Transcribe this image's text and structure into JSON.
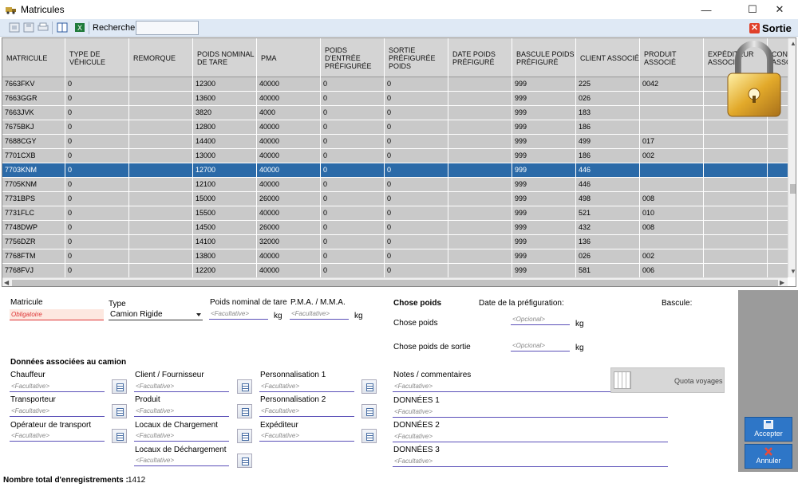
{
  "window": {
    "title": "Matricules",
    "minimize_glyph": "—",
    "maximize_glyph": "☐",
    "close_glyph": "✕"
  },
  "toolbar": {
    "search_label": "Rechercher:",
    "search_value": "",
    "exit_label": "Sortie",
    "icons": [
      "first-record-icon",
      "save-icon",
      "print-icon",
      "columns-icon",
      "excel-icon"
    ]
  },
  "grid": {
    "columns": [
      "MATRICULE",
      "TYPE DE VÉHICULE",
      "REMORQUE",
      "POIDS NOMINAL DE TARE",
      "PMA",
      "POIDS D'ENTRÉE PRÉFIGURÉE",
      "SORTIE PRÉFIGURÉE POIDS",
      "DATE POIDS PRÉFIGURÉ",
      "BASCULE POIDS PRÉFIGURÉ",
      "CLIENT ASSOCIÉ",
      "PRODUIT ASSOCIÉ",
      "EXPÉDITEUR ASSOCIÉ",
      "CON... ASSO..."
    ],
    "rows": [
      [
        "7663FKV",
        "0",
        "",
        "12300",
        "40000",
        "0",
        "0",
        "",
        "999",
        "225",
        "0042",
        "",
        ""
      ],
      [
        "7663GGR",
        "0",
        "",
        "13600",
        "40000",
        "0",
        "0",
        "",
        "999",
        "026",
        "",
        "",
        ""
      ],
      [
        "7663JVK",
        "0",
        "",
        "3820",
        "4000",
        "0",
        "0",
        "",
        "999",
        "183",
        "",
        "",
        ""
      ],
      [
        "7675BKJ",
        "0",
        "",
        "12800",
        "40000",
        "0",
        "0",
        "",
        "999",
        "186",
        "",
        "",
        ""
      ],
      [
        "7688CGY",
        "0",
        "",
        "14400",
        "40000",
        "0",
        "0",
        "",
        "999",
        "499",
        "017",
        "",
        ""
      ],
      [
        "7701CXB",
        "0",
        "",
        "13000",
        "40000",
        "0",
        "0",
        "",
        "999",
        "186",
        "002",
        "",
        ""
      ],
      [
        "7703KNM",
        "0",
        "",
        "12700",
        "40000",
        "0",
        "0",
        "",
        "999",
        "446",
        "",
        "",
        ""
      ],
      [
        "7705KNM",
        "0",
        "",
        "12100",
        "40000",
        "0",
        "0",
        "",
        "999",
        "446",
        "",
        "",
        ""
      ],
      [
        "7731BPS",
        "0",
        "",
        "15000",
        "26000",
        "0",
        "0",
        "",
        "999",
        "498",
        "008",
        "",
        ""
      ],
      [
        "7731FLC",
        "0",
        "",
        "15500",
        "40000",
        "0",
        "0",
        "",
        "999",
        "521",
        "010",
        "",
        ""
      ],
      [
        "7748DWP",
        "0",
        "",
        "14500",
        "26000",
        "0",
        "0",
        "",
        "999",
        "432",
        "008",
        "",
        ""
      ],
      [
        "7756DZR",
        "0",
        "",
        "14100",
        "32000",
        "0",
        "0",
        "",
        "999",
        "136",
        "",
        "",
        ""
      ],
      [
        "7768FTM",
        "0",
        "",
        "13800",
        "40000",
        "0",
        "0",
        "",
        "999",
        "026",
        "002",
        "",
        ""
      ],
      [
        "7768FVJ",
        "0",
        "",
        "12200",
        "40000",
        "0",
        "0",
        "",
        "999",
        "581",
        "006",
        "",
        ""
      ]
    ],
    "selected_row": 6
  },
  "form": {
    "matricule": {
      "label": "Matricule",
      "placeholder": "Obligatoire"
    },
    "type": {
      "label": "Type",
      "value": "Camion Rigide"
    },
    "tare": {
      "label": "Poids nominal de tare",
      "placeholder": "<Facultative>",
      "unit": "kg"
    },
    "pma": {
      "label": "P.M.A. / M.M.A.",
      "placeholder": "<Facultative>",
      "unit": "kg"
    },
    "chose_poids_title": "Chose poids",
    "date_prefig_label": "Date de la préfiguration:",
    "bascule_label": "Bascule:",
    "chose_poids": {
      "label": "Chose poids",
      "placeholder": "<Opcional>",
      "unit": "kg"
    },
    "chose_poids_sortie": {
      "label": "Chose poids de sortie",
      "placeholder": "<Opcional>",
      "unit": "kg"
    },
    "section_title": "Données associées au camion",
    "chauffeur": {
      "label": "Chauffeur",
      "placeholder": "<Facultative>"
    },
    "transporteur": {
      "label": "Transporteur",
      "placeholder": "<Facultative>"
    },
    "operateur": {
      "label": "Opérateur de transport",
      "placeholder": "<Facultative>"
    },
    "client": {
      "label": "Client / Fournisseur",
      "placeholder": "<Facultative>"
    },
    "produit": {
      "label": "Produit",
      "placeholder": "<Facultative>"
    },
    "locaux_charg": {
      "label": "Locaux de Chargement",
      "placeholder": "<Facultative>"
    },
    "locaux_decharg": {
      "label": "Locaux de Déchargement",
      "placeholder": "<Facultative>"
    },
    "perso1": {
      "label": "Personnalisation 1",
      "placeholder": "<Facultative>"
    },
    "perso2": {
      "label": "Personnalisation 2",
      "placeholder": "<Facultative>"
    },
    "expediteur": {
      "label": "Expéditeur",
      "placeholder": "<Facultative>"
    },
    "notes": {
      "label": "Notes / commentaires",
      "placeholder": "<Facultative>"
    },
    "donnees1": {
      "label": "DONNÉES 1",
      "placeholder": "<Facultative>"
    },
    "donnees2": {
      "label": "DONNÉES 2",
      "placeholder": "<Facultative>"
    },
    "donnees3": {
      "label": "DONNÉES 3",
      "placeholder": "<Facultative>"
    },
    "quota_label": "Quota voyages"
  },
  "actions": {
    "accept_label": "Accepter",
    "cancel_label": "Annuler"
  },
  "status": {
    "total_label": "Nombre total d'enregistrements :",
    "total_value": "1412"
  },
  "colors": {
    "accent": "#2b6aa8",
    "button": "#2e76c7",
    "required": "#d33333"
  }
}
